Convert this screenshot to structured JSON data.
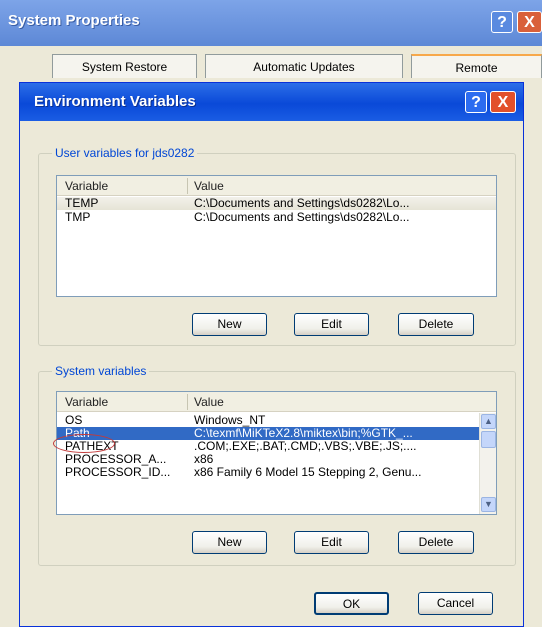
{
  "system_properties": {
    "title": "System Properties",
    "help_icon": "?",
    "close_icon": "X",
    "tabs": [
      {
        "label": "System Restore"
      },
      {
        "label": "Automatic Updates"
      },
      {
        "label": "Remote"
      }
    ]
  },
  "env_dialog": {
    "title": "Environment Variables",
    "help_icon": "?",
    "close_icon": "X",
    "user_group": {
      "label": "User variables for jds0282",
      "columns": [
        "Variable",
        "Value"
      ],
      "rows": [
        {
          "variable": "TEMP",
          "value": "C:\\Documents and Settings\\ds0282\\Lo..."
        },
        {
          "variable": "TMP",
          "value": "C:\\Documents and Settings\\ds0282\\Lo..."
        }
      ],
      "buttons": {
        "new": "New",
        "edit": "Edit",
        "delete": "Delete"
      }
    },
    "system_group": {
      "label": "System variables",
      "columns": [
        "Variable",
        "Value"
      ],
      "rows": [
        {
          "variable": "OS",
          "value": "Windows_NT"
        },
        {
          "variable": "Path",
          "value": "C:\\texmf\\MiKTeX2.8\\miktex\\bin;%GTK_..."
        },
        {
          "variable": "PATHEXT",
          "value": ".COM;.EXE;.BAT;.CMD;.VBS;.VBE;.JS;...."
        },
        {
          "variable": "PROCESSOR_A...",
          "value": "x86"
        },
        {
          "variable": "PROCESSOR_ID...",
          "value": "x86 Family 6 Model 15 Stepping 2, Genu..."
        }
      ],
      "selected_row": "Path",
      "buttons": {
        "new": "New",
        "edit": "Edit",
        "delete": "Delete"
      }
    },
    "ok_label": "OK",
    "cancel_label": "Cancel"
  },
  "colors": {
    "title_bar": "#0a49d8",
    "selection": "#316ac5",
    "group_label": "#0046d5",
    "highlight_circle": "#c23b3b",
    "dialog_bg": "#ece9d8"
  }
}
